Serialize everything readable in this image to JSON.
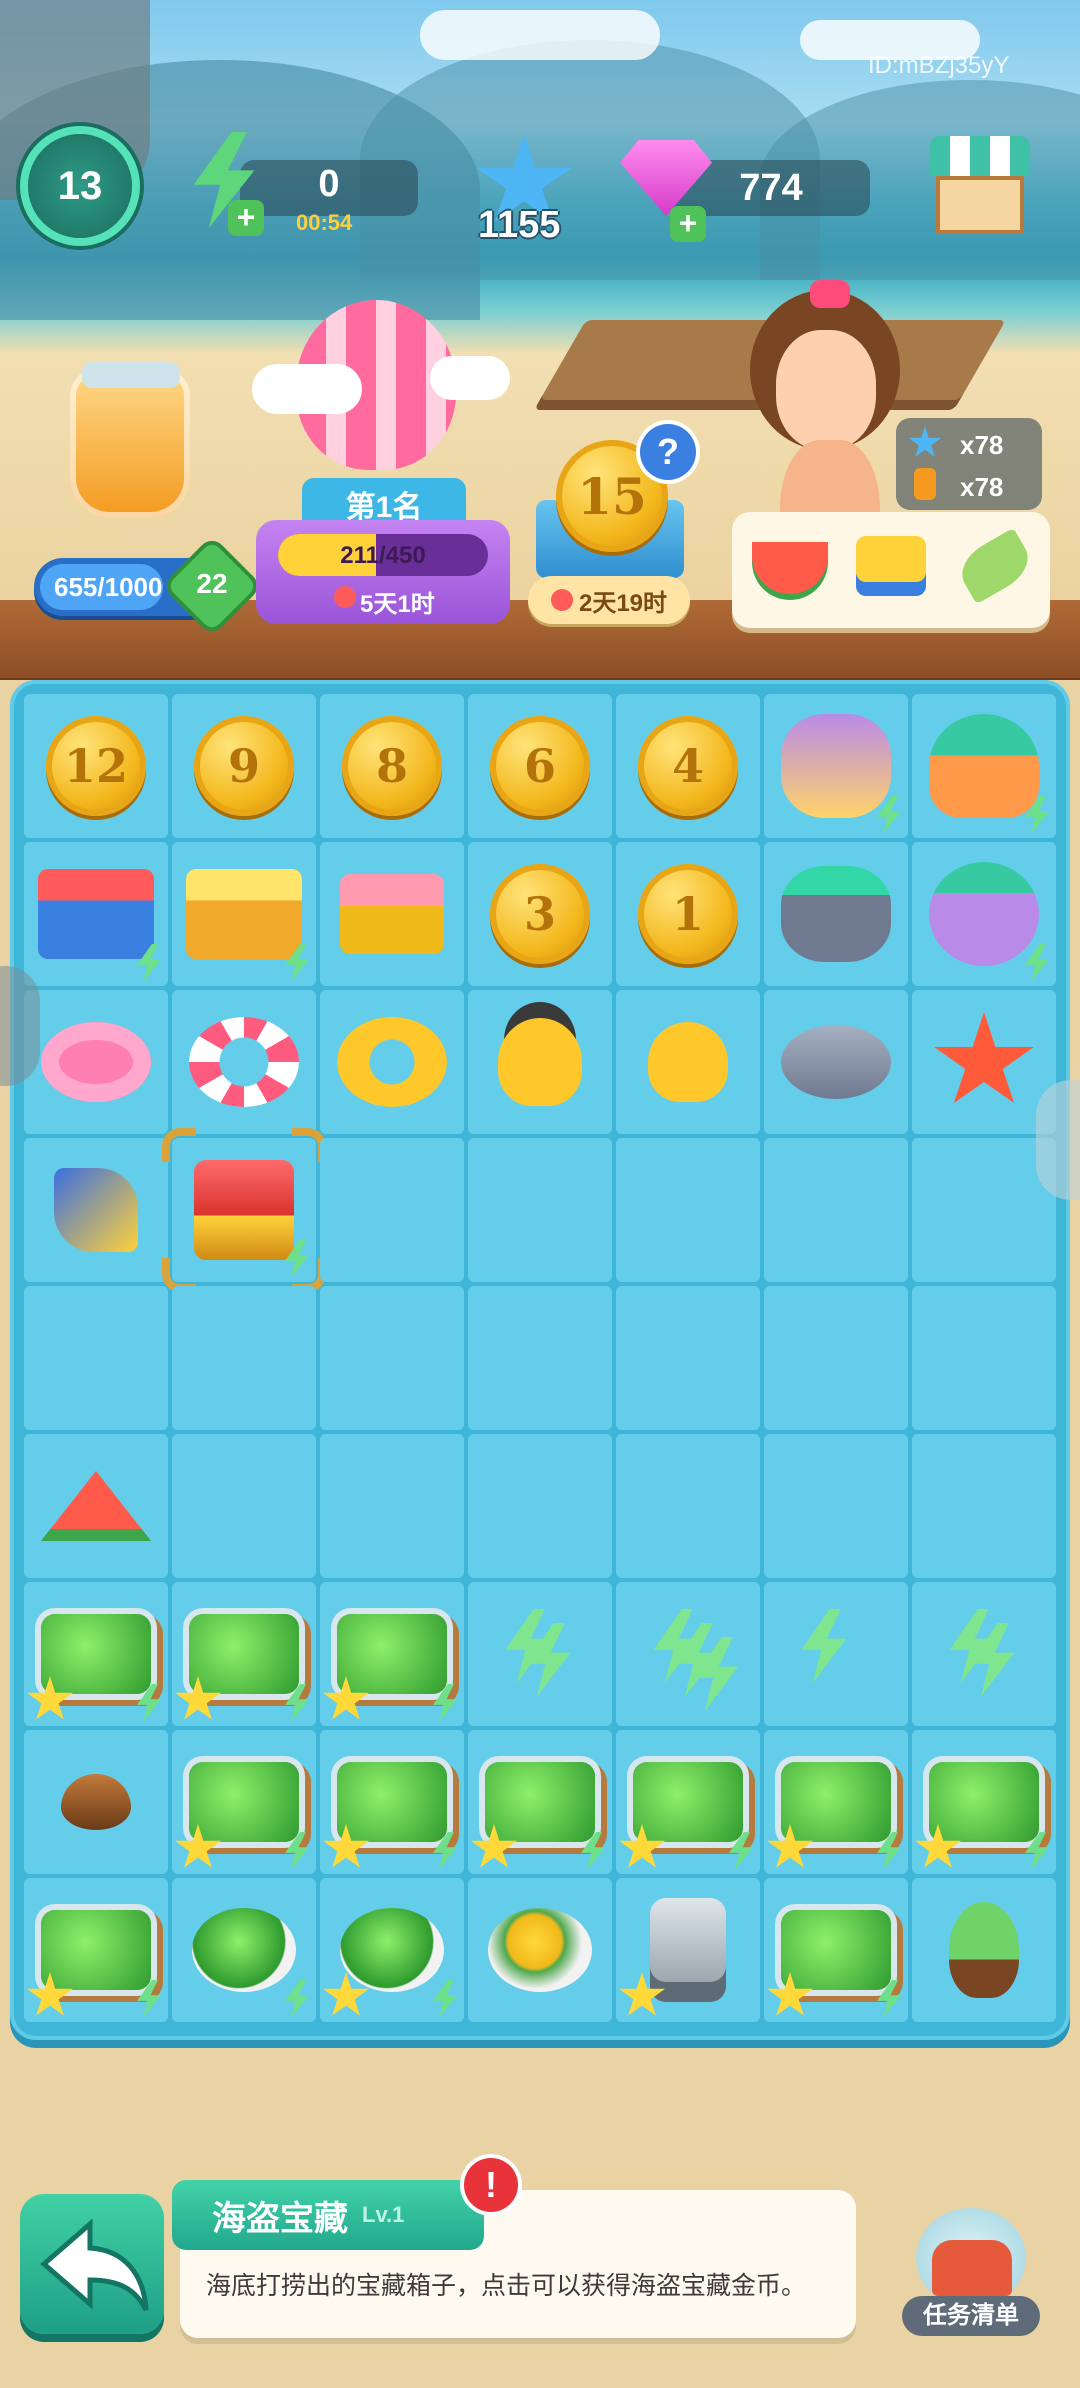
{
  "hud": {
    "level": "13",
    "energy_value": "0",
    "energy_timer": "00:54",
    "stars": "1155",
    "gems": "774",
    "player_id": "ID:mBZj35yY"
  },
  "jar": {
    "progress_text": "655/1000",
    "badge": "22",
    "progress": 0.655
  },
  "balloon": {
    "rank": "第1名",
    "progress_text": "211/450",
    "timer": "5天1时",
    "progress": 0.469
  },
  "coin_event": {
    "coin_value": "15",
    "help": "?",
    "timer": "2天19时"
  },
  "order": {
    "count_star": "x78",
    "count_jar": "x78"
  },
  "board": {
    "rows": [
      [
        {
          "t": "coin",
          "v": "12"
        },
        {
          "t": "coin",
          "v": "9"
        },
        {
          "t": "coin",
          "v": "8"
        },
        {
          "t": "coin",
          "v": "6"
        },
        {
          "t": "coin",
          "v": "4"
        },
        {
          "t": "shell-coral",
          "b": true
        },
        {
          "t": "clam-coral",
          "b": true
        }
      ],
      [
        {
          "t": "basket",
          "b": true
        },
        {
          "t": "basket2",
          "b": true
        },
        {
          "t": "crate"
        },
        {
          "t": "coin",
          "v": "3"
        },
        {
          "t": "coin",
          "v": "1"
        },
        {
          "t": "rock-coral"
        },
        {
          "t": "pearl-coral",
          "b": true
        }
      ],
      [
        {
          "t": "flamingo"
        },
        {
          "t": "ring"
        },
        {
          "t": "duck-ring"
        },
        {
          "t": "duck-hat"
        },
        {
          "t": "duck"
        },
        {
          "t": "rock"
        },
        {
          "t": "starfish"
        }
      ],
      [
        {
          "t": "shovel"
        },
        {
          "t": "chest",
          "b": true,
          "sel": true
        },
        {},
        {},
        {},
        {},
        {}
      ],
      [
        {},
        {},
        {},
        {},
        {},
        {},
        {}
      ],
      [
        {
          "t": "watermelon"
        },
        {},
        {},
        {},
        {},
        {},
        {}
      ],
      [
        {
          "t": "melon-cart",
          "s": true,
          "b": true
        },
        {
          "t": "melon-cart",
          "s": true,
          "b": true
        },
        {
          "t": "melon-cart",
          "s": true,
          "b": true
        },
        {
          "t": "energy2"
        },
        {
          "t": "energy3"
        },
        {
          "t": "energy1"
        },
        {
          "t": "energy2"
        }
      ],
      [
        {
          "t": "seed"
        },
        {
          "t": "melon-cart",
          "s": true,
          "b": true
        },
        {
          "t": "melon-cart",
          "s": true,
          "b": true
        },
        {
          "t": "melon-cart",
          "s": true,
          "b": true
        },
        {
          "t": "melon-cart",
          "s": true,
          "b": true
        },
        {
          "t": "melon-cart",
          "s": true,
          "b": true
        },
        {
          "t": "melon-cart",
          "s": true,
          "b": true
        }
      ],
      [
        {
          "t": "melon-cart",
          "s": true,
          "b": true
        },
        {
          "t": "melon-plate",
          "b": true
        },
        {
          "t": "melon-plate",
          "s": true,
          "b": true
        },
        {
          "t": "flower-plate"
        },
        {
          "t": "machine",
          "s": true
        },
        {
          "t": "melon-cart",
          "s": true,
          "b": true
        },
        {
          "t": "sprout"
        }
      ]
    ]
  },
  "info": {
    "item_name": "海盗宝藏",
    "item_level": "Lv.1",
    "alert": "!",
    "description": "海底打捞出的宝藏箱子，点击可以获得海盗宝藏金币。"
  },
  "task_list_label": "任务清单",
  "colors": {
    "board": "#3fb6d8",
    "cell": "#63cdea",
    "accent": "#22a88d",
    "gem": "#e94ad6"
  }
}
